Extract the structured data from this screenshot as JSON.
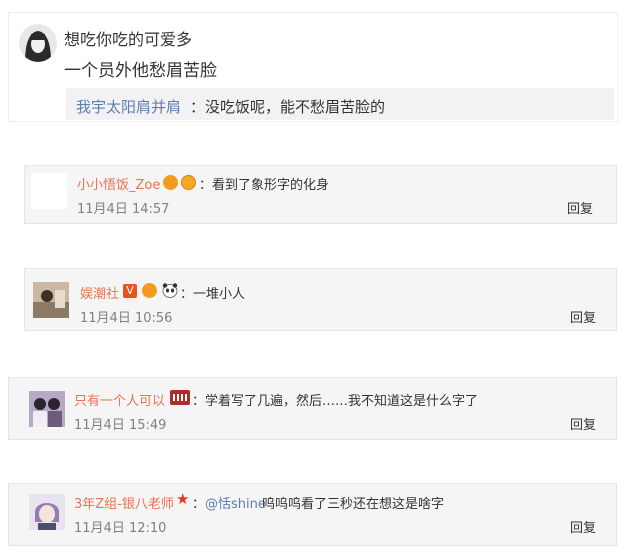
{
  "top_post": {
    "author": "想吃你吃的可爱多",
    "text": "一个员外他愁眉苦脸",
    "reply_author": "我宇太阳肩并肩",
    "reply_text": "：没吃饭呢，能不愁眉苦脸的"
  },
  "comments": [
    {
      "author": "小小悟饭_Zoe",
      "text": "：看到了象形字的化身",
      "time": "11月4日 14:57",
      "reply_label": "回复",
      "avatar_icon": "blank-avatar"
    },
    {
      "author": "娱潮社",
      "text": "：一堆小人",
      "time": "11月4日 10:56",
      "reply_label": "回复",
      "avatar_icon": "photo-avatar"
    },
    {
      "author": "只有一个人可以",
      "text": "：学着写了几遍，然后……我不知道这是什么字了",
      "time": "11月4日 15:49",
      "reply_label": "回复",
      "avatar_icon": "photo-avatar"
    },
    {
      "author": "3年Z组-银八老师",
      "mention": "@恬shine",
      "text": " 呜呜呜看了三秒还在想这是啥字",
      "time": "11月4日 12:10",
      "reply_label": "回复",
      "avatar_icon": "anime-avatar"
    }
  ],
  "colors": {
    "author": "#eb7350",
    "link": "#5d7fb0",
    "card_bg": "#f5f5f5"
  }
}
